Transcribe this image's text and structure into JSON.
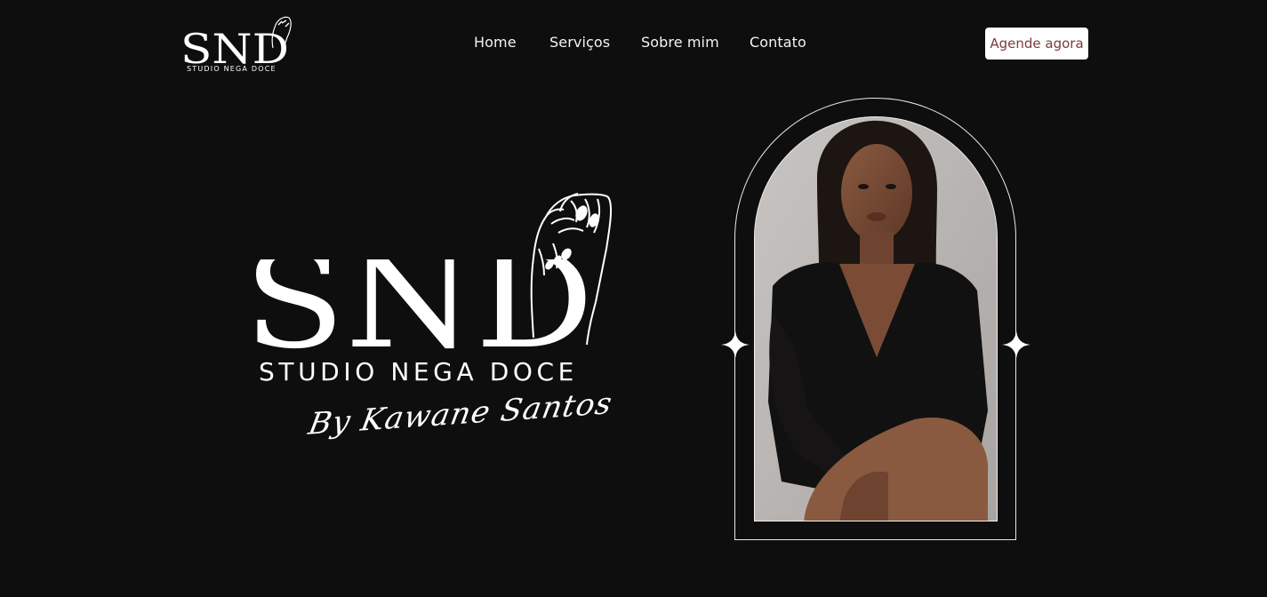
{
  "header": {
    "brand": {
      "letters": "SND",
      "tagline": "STUDIO NEGA DOCE"
    },
    "nav": [
      {
        "label": "Home"
      },
      {
        "label": "Serviços"
      },
      {
        "label": "Sobre mim"
      },
      {
        "label": "Contato"
      }
    ],
    "cta_label": "Agende agora"
  },
  "hero": {
    "logo_letters": "SND",
    "subtitle": "STUDIO NEGA DOCE",
    "signature": "By Kawane Santos"
  },
  "portrait": {
    "icon": "woman-portrait-photo"
  },
  "colors": {
    "background": "#0e0e0f",
    "text": "#ffffff",
    "cta_text": "#7a3b3e"
  }
}
